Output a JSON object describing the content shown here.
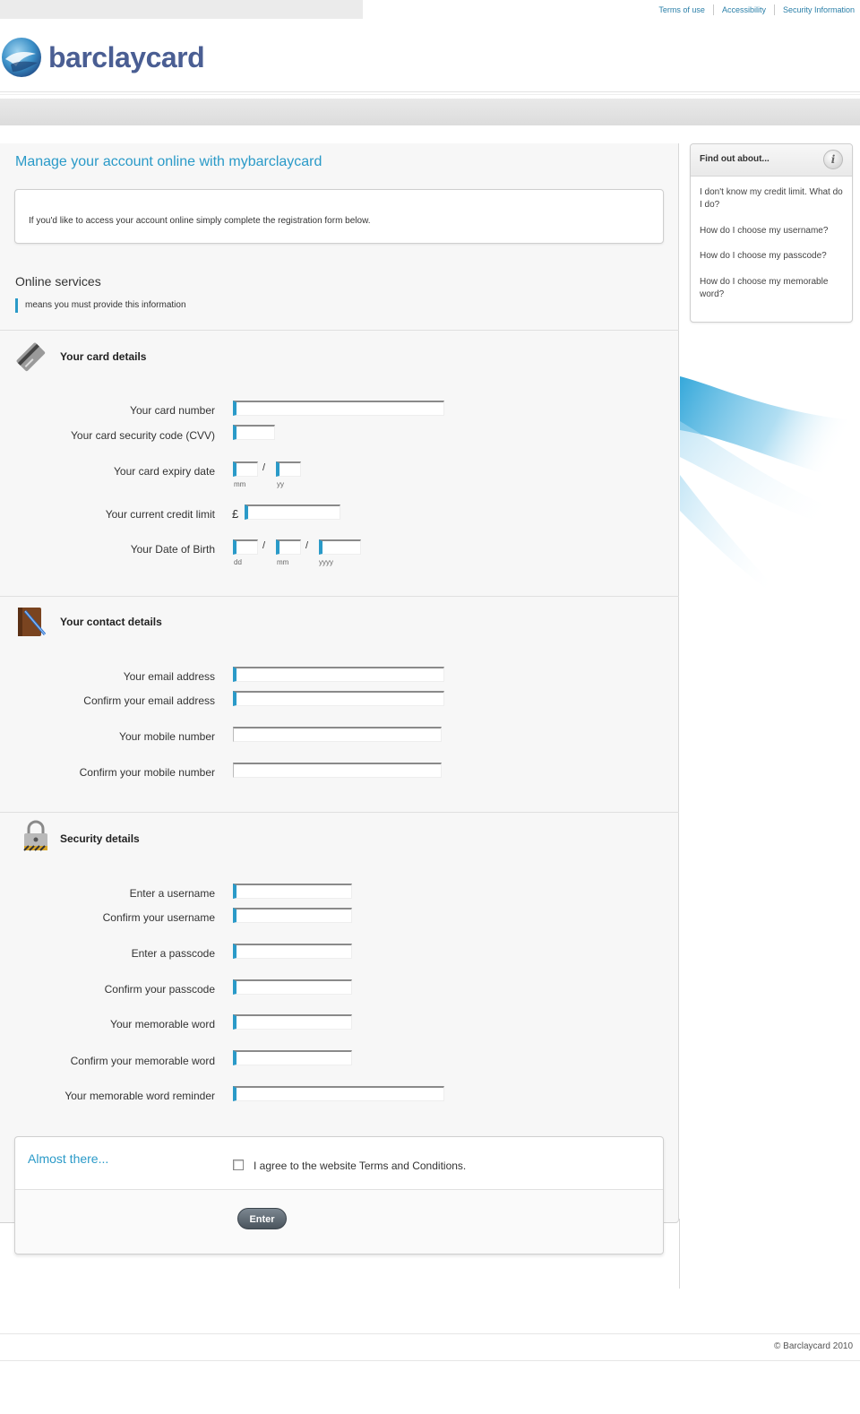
{
  "header": {
    "links": [
      "Terms of use",
      "Accessibility",
      "Security Information"
    ],
    "logo_text": "barclaycard"
  },
  "main": {
    "title": "Manage your account online with mybarclaycard",
    "intro": "If you'd like to access your account online simply complete the registration form below.",
    "online_services": "Online services",
    "required_note": "means you must provide this information"
  },
  "card_section": {
    "title": "Your card details",
    "icon": "credit-card-icon",
    "labels": {
      "card_number": "Your card number",
      "cvv": "Your card security code (CVV)",
      "expiry": "Your card expiry date",
      "credit_limit": "Your current credit limit",
      "dob": "Your Date of Birth"
    },
    "expiry_sub": [
      "mm",
      "yy"
    ],
    "dob_sub": [
      "dd",
      "mm",
      "yyyy"
    ],
    "date_separator": "/",
    "currency": "£"
  },
  "contact_section": {
    "title": "Your contact details",
    "icon": "address-book-icon",
    "labels": {
      "email": "Your email address",
      "confirm_email": "Confirm your email address",
      "mobile": "Your mobile number",
      "confirm_mobile": "Confirm your mobile number"
    }
  },
  "security_section": {
    "title": "Security details",
    "icon": "padlock-icon",
    "labels": {
      "username": "Enter a username",
      "confirm_username": "Confirm your username",
      "passcode": "Enter a passcode",
      "confirm_passcode": "Confirm your passcode",
      "memorable": "Your memorable word",
      "confirm_memorable": "Confirm your memorable word",
      "reminder": "Your memorable word reminder"
    }
  },
  "final": {
    "heading": "Almost there...",
    "agree": "I agree to the website Terms and Conditions.",
    "enter": "Enter"
  },
  "sidebar": {
    "title": "Find out about...",
    "icon": "info-icon",
    "links": [
      "I don't know my credit limit. What do I do?",
      "How do I choose my username?",
      "How do I choose my passcode?",
      "How do I choose my memorable word?"
    ]
  },
  "footer": {
    "copyright": "© Barclaycard 2010"
  },
  "colors": {
    "accent": "#2a9ac8",
    "brand": "#4a5e93"
  }
}
